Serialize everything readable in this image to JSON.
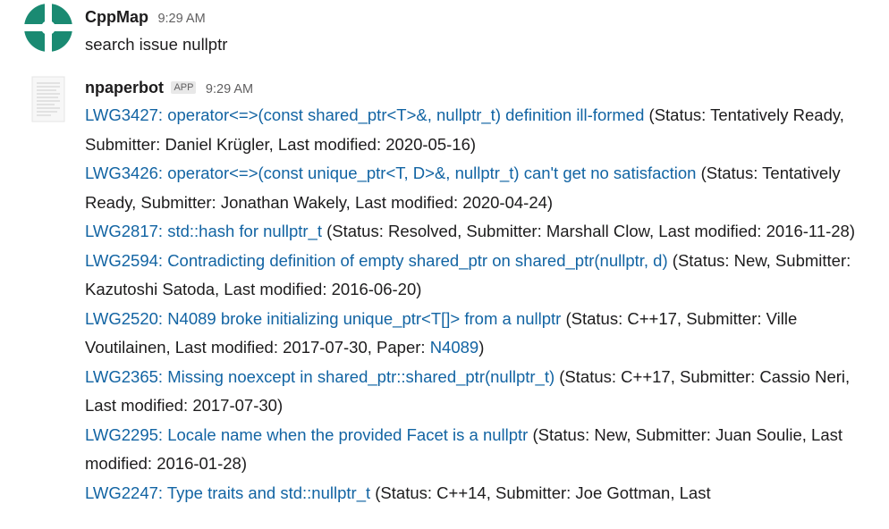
{
  "messages": [
    {
      "author": "CppMap",
      "time": "9:29 AM",
      "text": "search issue nullptr"
    },
    {
      "author": "npaperbot",
      "badge": "APP",
      "time": "9:29 AM"
    }
  ],
  "results": [
    {
      "link": "LWG3427: operator<=>(const shared_ptr<T>&, nullptr_t) definition ill-formed",
      "details": " (Status: Tentatively Ready, Submitter: Daniel Krügler, Last modified: 2020-05-16)"
    },
    {
      "link": "LWG3426: operator<=>(const unique_ptr<T, D>&, nullptr_t) can't get no satisfaction",
      "details": " (Status: Tentatively Ready, Submitter: Jonathan Wakely, Last modified: 2020-04-24)"
    },
    {
      "link": "LWG2817: std::hash for nullptr_t",
      "details": " (Status: Resolved, Submitter: Marshall Clow, Last modified: 2016-11-28)"
    },
    {
      "link": "LWG2594: Contradicting definition of empty shared_ptr on shared_ptr(nullptr, d)",
      "details": " (Status: New, Submitter: Kazutoshi Satoda, Last modified: 2016-06-20)"
    },
    {
      "link": "LWG2520: N4089 broke initializing unique_ptr<T[]> from a nullptr",
      "details": " (Status: C++17, Submitter: Ville Voutilainen, Last modified: 2017-07-30, Paper: ",
      "paper": "N4089",
      "suffix": ")"
    },
    {
      "link": "LWG2365: Missing noexcept in shared_ptr::shared_ptr(nullptr_t)",
      "details": " (Status: C++17, Submitter: Cassio Neri, Last modified: 2017-07-30)"
    },
    {
      "link": "LWG2295: Locale name when the provided Facet is a nullptr",
      "details": " (Status: New, Submitter: Juan Soulie, Last modified: 2016-01-28)"
    },
    {
      "link": "LWG2247: Type traits and std::nullptr_t",
      "details": " (Status: C++14, Submitter: Joe Gottman, Last"
    }
  ],
  "colors": {
    "link": "#1264a3",
    "avatar": "#1a8a72",
    "text": "#1d1c1d",
    "meta": "#616061"
  },
  "icons": {
    "cppmap_avatar": "cppmap-logo-icon",
    "npaperbot_avatar": "document-icon"
  }
}
